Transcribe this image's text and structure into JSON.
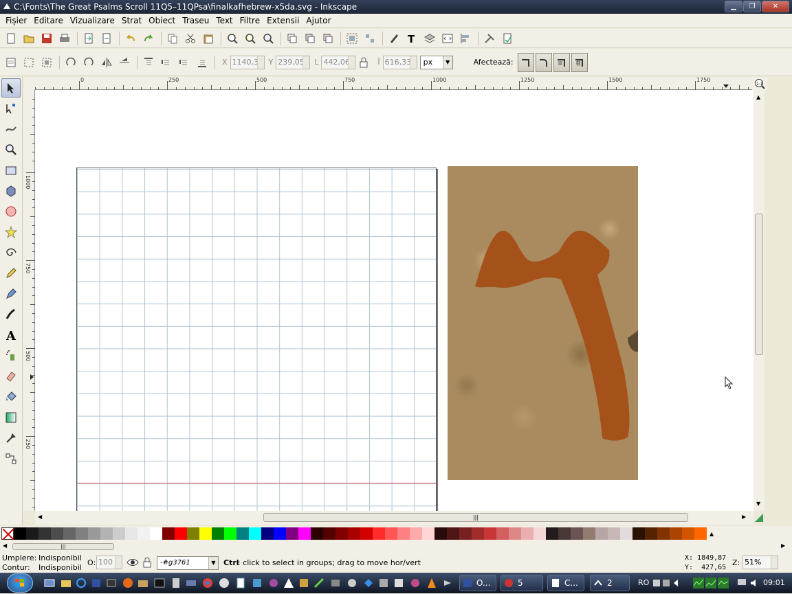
{
  "window": {
    "title": "C:\\Fonts\\The Great Psalms Scroll 11Q5–11QPsa\\finalkafhebrew-x5da.svg - Inkscape"
  },
  "menu": [
    "Fișier",
    "Editare",
    "Vizualizare",
    "Strat",
    "Obiect",
    "Traseu",
    "Text",
    "Filtre",
    "Extensii",
    "Ajutor"
  ],
  "controls": {
    "x_label": "X",
    "x_value": "1140,35",
    "y_label": "Y",
    "y_value": "239,053",
    "w_label": "L",
    "w_value": "442,068",
    "h_label": "Î",
    "h_value": "616,330",
    "unit": "px",
    "affect_label": "Afectează:"
  },
  "rulers": {
    "h_ticks": [
      "0",
      "250",
      "500",
      "750",
      "1000",
      "1250",
      "1500",
      "1750"
    ],
    "v_ticks": [
      "1000",
      "750",
      "500",
      "250"
    ]
  },
  "colors": {
    "ink": "#a5521a",
    "grid": "#aec4d4",
    "guide": "#e05050",
    "parchment": "#a98b5f"
  },
  "palette": [
    "#000000",
    "#1a1a1a",
    "#333333",
    "#4d4d4d",
    "#666666",
    "#808080",
    "#999999",
    "#b3b3b3",
    "#cccccc",
    "#e6e6e6",
    "#f2f2f2",
    "#ffffff",
    "#800000",
    "#ff0000",
    "#808000",
    "#ffff00",
    "#008000",
    "#00ff00",
    "#008080",
    "#00ffff",
    "#000080",
    "#0000ff",
    "#800080",
    "#ff00ff",
    "#2b0000",
    "#550000",
    "#800000",
    "#aa0000",
    "#d40000",
    "#ff2a2a",
    "#ff5555",
    "#ff8080",
    "#ffaaaa",
    "#ffd5d5",
    "#280b0b",
    "#501616",
    "#782121",
    "#a02c2c",
    "#c83737",
    "#d35f5f",
    "#de8787",
    "#e9afaf",
    "#f4d7d7",
    "#241c1c",
    "#483737",
    "#6c5353",
    "#917c6f",
    "#b7a6a6",
    "#c8b7b7",
    "#e3dbdb",
    "#2b1100",
    "#552200",
    "#803300",
    "#aa4400",
    "#d45500",
    "#ff6600"
  ],
  "status": {
    "fill_label": "Umplere:",
    "fill_value": "Indisponibil",
    "stroke_label": "Contur:",
    "stroke_value": "Indisponibil",
    "opacity_label": "O:",
    "opacity_value": "100",
    "layer": "-#g3761",
    "message_key": "Ctrl",
    "message": ": click to select in groups; drag to move hor/vert",
    "cursor_x": "X: 1849,87",
    "cursor_y": "Y:  427,65",
    "zoom_label": "Z:",
    "zoom": "51%"
  },
  "taskbar": {
    "items": [
      "O...",
      "5",
      "C...",
      "2"
    ],
    "lang": "RO",
    "clock": "09:01"
  }
}
